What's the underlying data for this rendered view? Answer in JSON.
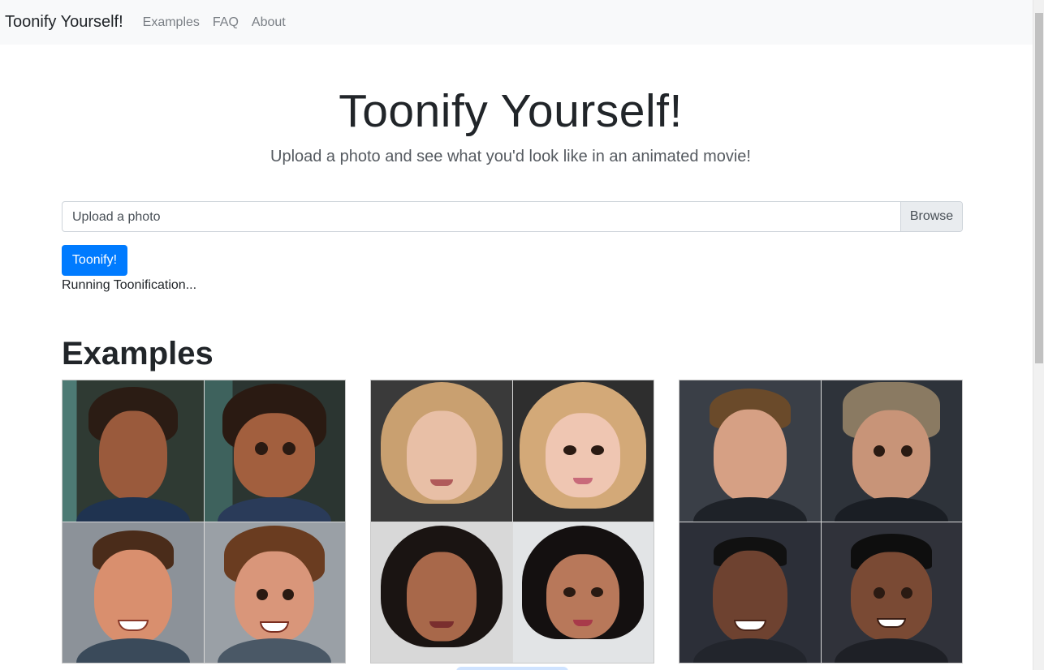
{
  "navbar": {
    "brand": "Toonify Yourself!",
    "links": [
      "Examples",
      "FAQ",
      "About"
    ]
  },
  "hero": {
    "title": "Toonify Yourself!",
    "subtitle": "Upload a photo and see what you'd look like in an animated movie!"
  },
  "upload": {
    "label": "Upload a photo",
    "browse_label": "Browse"
  },
  "toonify_button": "Toonify!",
  "status_text": "Running Toonification...",
  "examples_heading": "Examples",
  "colors": {
    "primary": "#007bff",
    "navbar_bg": "#f8f9fa"
  }
}
